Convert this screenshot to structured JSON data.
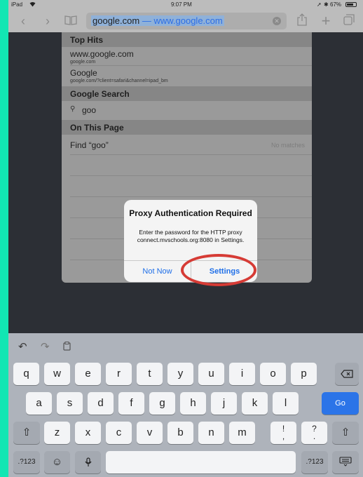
{
  "status": {
    "device": "iPad",
    "wifi_icon": "wifi-icon",
    "time": "9:07 PM",
    "battery": "67%"
  },
  "toolbar": {
    "url_domain": "google.com",
    "url_full": "— www.google.com"
  },
  "suggestions": {
    "top_hits_label": "Top Hits",
    "hits": [
      {
        "title": "www.google.com",
        "subtitle": "google.com"
      },
      {
        "title": "Google",
        "subtitle": "google.com/?client=safari&channel=ipad_bm"
      }
    ],
    "search_label": "Google Search",
    "search_query": "goo",
    "on_page_label": "On This Page",
    "find_label": "Find “goo”",
    "find_result": "No matches"
  },
  "dialog": {
    "title": "Proxy Authentication Required",
    "message": "Enter the password for the HTTP proxy connect.mvschools.org:8080 in Settings.",
    "cancel": "Not Now",
    "confirm": "Settings"
  },
  "keyboard": {
    "row1": [
      "q",
      "w",
      "e",
      "r",
      "t",
      "y",
      "u",
      "i",
      "o",
      "p"
    ],
    "row2": [
      "a",
      "s",
      "d",
      "f",
      "g",
      "h",
      "j",
      "k",
      "l"
    ],
    "row3": [
      "z",
      "x",
      "c",
      "v",
      "b",
      "n",
      "m"
    ],
    "punct1": [
      "!",
      ","
    ],
    "punct2": [
      "?",
      "."
    ],
    "go": "Go",
    "numbers": ".?123",
    "accent_color": "#2b74e8"
  }
}
